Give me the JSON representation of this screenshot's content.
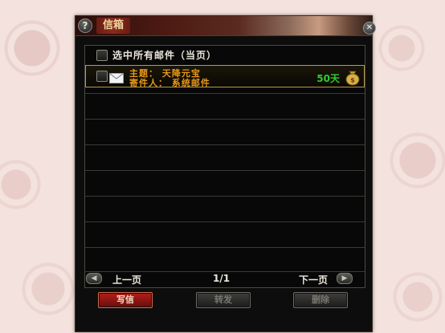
{
  "window": {
    "title": "信箱"
  },
  "header": {
    "select_all_label": "选中所有邮件（当页）"
  },
  "mails": [
    {
      "subject_line": "主题：  天降元宝",
      "sender_line": "寄件人：  系统邮件",
      "days_left": "50天",
      "icon": "envelope-icon",
      "attachment_icon": "money-bag-icon"
    }
  ],
  "pager": {
    "prev_label": "上一页",
    "page_indicator": "1/1",
    "next_label": "下一页"
  },
  "buttons": {
    "write_label": "写信",
    "forward_label": "转发",
    "delete_label": "删除"
  },
  "colors": {
    "accent_red": "#8a1a14",
    "mail_text": "#e89818",
    "days_text": "#2ecc30",
    "panel_bg": "#0d0d0d"
  }
}
